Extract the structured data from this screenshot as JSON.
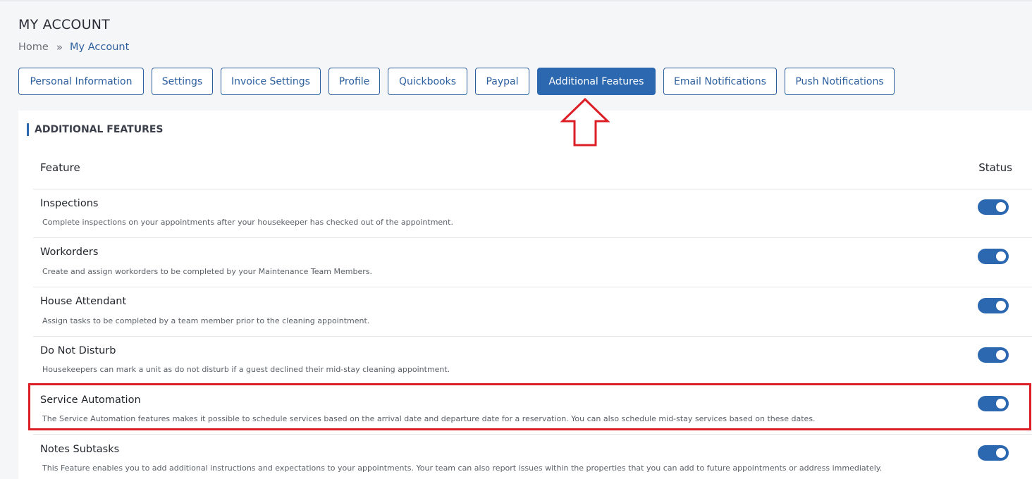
{
  "header": {
    "title": "MY ACCOUNT",
    "breadcrumb": {
      "home": "Home",
      "separator": "»",
      "current": "My Account"
    }
  },
  "tabs": [
    {
      "label": "Personal Information",
      "active": false
    },
    {
      "label": "Settings",
      "active": false
    },
    {
      "label": "Invoice Settings",
      "active": false
    },
    {
      "label": "Profile",
      "active": false
    },
    {
      "label": "Quickbooks",
      "active": false
    },
    {
      "label": "Paypal",
      "active": false
    },
    {
      "label": "Additional Features",
      "active": true
    },
    {
      "label": "Email Notifications",
      "active": false
    },
    {
      "label": "Push Notifications",
      "active": false
    }
  ],
  "section": {
    "title": "ADDITIONAL FEATURES",
    "columns": {
      "feature": "Feature",
      "status": "Status"
    },
    "rows": [
      {
        "title": "Inspections",
        "description": "Complete inspections on your appointments after your housekeeper has checked out of the appointment.",
        "enabled": true
      },
      {
        "title": "Workorders",
        "description": "Create and assign workorders to be completed by your Maintenance Team Members.",
        "enabled": true
      },
      {
        "title": "House Attendant",
        "description": "Assign tasks to be completed by a team member prior to the cleaning appointment.",
        "enabled": true
      },
      {
        "title": "Do Not Disturb",
        "description": "Housekeepers can mark a unit as do not disturb if a guest declined their mid-stay cleaning appointment.",
        "enabled": true
      },
      {
        "title": "Service Automation",
        "description": "The Service Automation features makes it possible to schedule services based on the arrival date and departure date for a reservation. You can also schedule mid-stay services based on these dates.",
        "enabled": true
      },
      {
        "title": "Notes Subtasks",
        "description": "This Feature enables you to add additional instructions and expectations to your appointments. Your team can also report issues within the properties that you can add to future appointments or address immediately.",
        "enabled": true
      }
    ]
  },
  "annotations": {
    "arrow_color": "#dc1f26",
    "highlight_color": "#dc1f26",
    "highlighted_row": "Service Automation"
  },
  "colors": {
    "accent": "#2c68b0",
    "tab_border": "#2c5f9e",
    "background": "#f5f6f8"
  }
}
